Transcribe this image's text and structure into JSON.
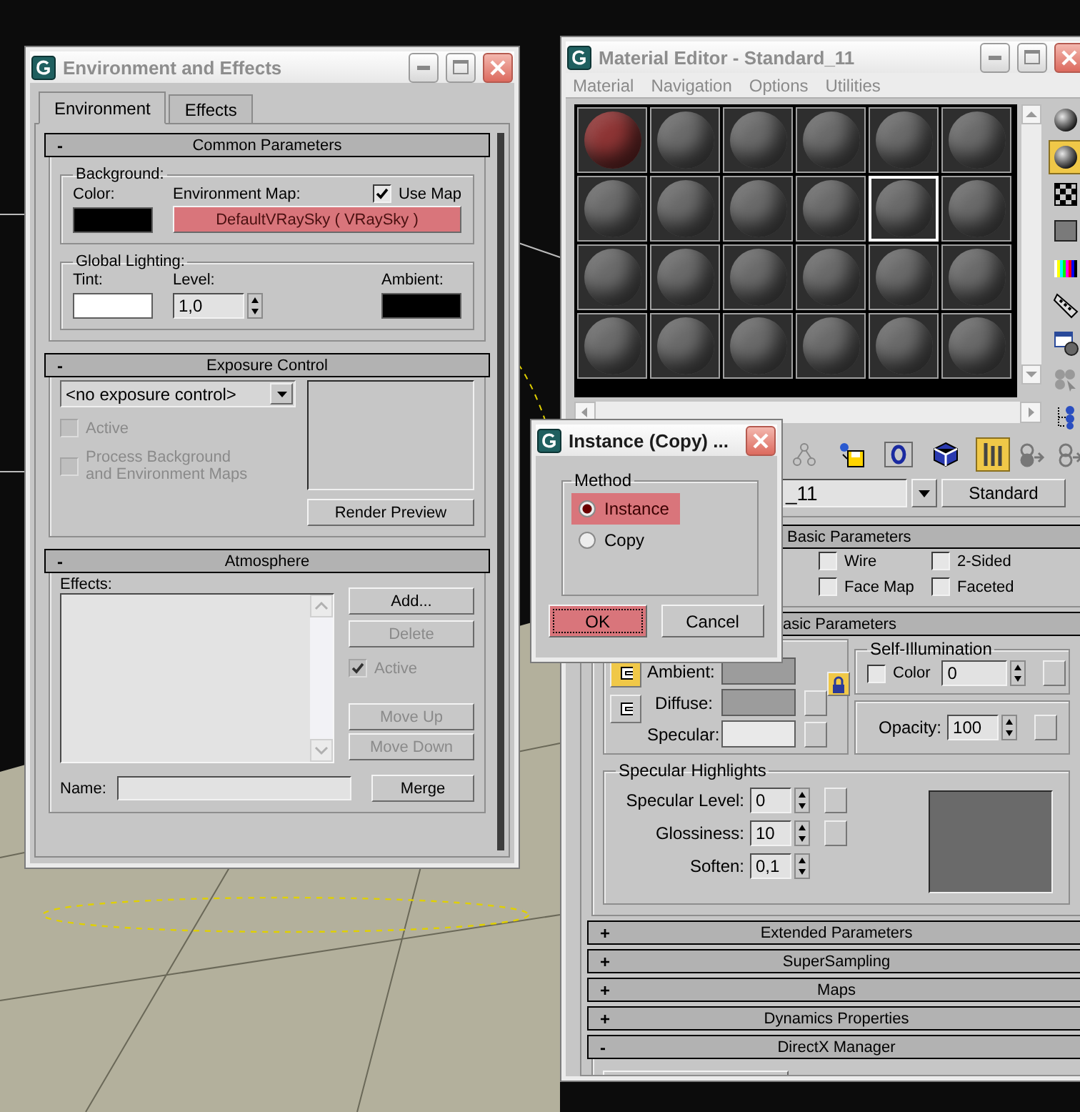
{
  "environment_window": {
    "title": "Environment and Effects",
    "tabs": [
      {
        "label": "Environment",
        "selected": true
      },
      {
        "label": "Effects",
        "selected": false
      }
    ],
    "common_parameters": {
      "toggle": "-",
      "title": "Common Parameters",
      "background": {
        "label": "Background:",
        "use_map": {
          "label": "Use Map",
          "checked": true
        },
        "items": [
          {
            "kind": "swatch",
            "label": "Color:",
            "color": "#000000"
          },
          {
            "kind": "map",
            "label": "Environment Map:",
            "button": "DefaultVRaySky  ( VRaySky )",
            "highlighted": true
          }
        ]
      },
      "global_lighting": {
        "label": "Global Lighting:",
        "items": [
          {
            "kind": "swatch",
            "label": "Tint:",
            "color": "#ffffff"
          },
          {
            "kind": "spinner",
            "label": "Level:",
            "value": "1,0"
          },
          {
            "kind": "swatch",
            "label": "Ambient:",
            "color": "#000000"
          }
        ]
      }
    },
    "exposure_control": {
      "toggle": "-",
      "title": "Exposure Control",
      "dropdown": "<no exposure control>",
      "options": [
        {
          "label": "Active",
          "checked": false,
          "disabled": true
        },
        {
          "label": "Process Background and Environment Maps",
          "checked": false,
          "disabled": true
        }
      ],
      "render_preview": "Render Preview"
    },
    "atmosphere": {
      "toggle": "-",
      "title": "Atmosphere",
      "effects_label": "Effects:",
      "buttons": [
        {
          "label": "Add...",
          "disabled": false
        },
        {
          "label": "Delete",
          "disabled": true
        }
      ],
      "active": {
        "label": "Active",
        "checked": true,
        "disabled": true
      },
      "move_buttons": [
        {
          "label": "Move Up",
          "disabled": true
        },
        {
          "label": "Move Down",
          "disabled": true
        }
      ],
      "name_label": "Name:",
      "merge": "Merge"
    }
  },
  "material_editor": {
    "title": "Material Editor - Standard_11",
    "menu": [
      "Material",
      "Navigation",
      "Options",
      "Utilities"
    ],
    "slots": [
      {
        "color": "#8e3535",
        "selected": false
      },
      {
        "color": "#6b6b6b",
        "selected": false
      },
      {
        "color": "#6b6b6b",
        "selected": false
      },
      {
        "color": "#6b6b6b",
        "selected": false
      },
      {
        "color": "#6b6b6b",
        "selected": false
      },
      {
        "color": "#6b6b6b",
        "selected": false
      },
      {
        "color": "#6b6b6b",
        "selected": false
      },
      {
        "color": "#6b6b6b",
        "selected": false
      },
      {
        "color": "#6b6b6b",
        "selected": false
      },
      {
        "color": "#6b6b6b",
        "selected": false
      },
      {
        "color": "#6b6b6b",
        "selected": true
      },
      {
        "color": "#6b6b6b",
        "selected": false
      },
      {
        "color": "#6b6b6b",
        "selected": false
      },
      {
        "color": "#6b6b6b",
        "selected": false
      },
      {
        "color": "#6b6b6b",
        "selected": false
      },
      {
        "color": "#6b6b6b",
        "selected": false
      },
      {
        "color": "#6b6b6b",
        "selected": false
      },
      {
        "color": "#6b6b6b",
        "selected": false
      },
      {
        "color": "#6b6b6b",
        "selected": false
      },
      {
        "color": "#6b6b6b",
        "selected": false
      },
      {
        "color": "#6b6b6b",
        "selected": false
      },
      {
        "color": "#6b6b6b",
        "selected": false
      },
      {
        "color": "#6b6b6b",
        "selected": false
      },
      {
        "color": "#6b6b6b",
        "selected": false
      }
    ],
    "side_tools": [
      {
        "kind": "sphere",
        "active": false
      },
      {
        "kind": "backlight",
        "active": true
      },
      {
        "kind": "checker",
        "active": false
      },
      {
        "kind": "square",
        "active": false
      },
      {
        "kind": "colorbars",
        "active": false
      },
      {
        "kind": "film",
        "active": false
      },
      {
        "kind": "options",
        "active": false
      },
      {
        "kind": "select",
        "active": false
      },
      {
        "kind": "nodes",
        "active": false
      }
    ],
    "toolbar": [
      {
        "kind": "tree",
        "active": false
      },
      {
        "kind": "disk",
        "active": false
      },
      {
        "kind": "ring",
        "active": false
      },
      {
        "kind": "cube",
        "active": false
      },
      {
        "kind": "bars",
        "active": true
      },
      {
        "kind": "up",
        "active": false
      },
      {
        "kind": "across",
        "active": false
      }
    ],
    "name_field": "_11",
    "type_button": "Standard",
    "shader_rollout": {
      "title": "Basic Parameters",
      "options": [
        {
          "label": "Wire",
          "checked": false
        },
        {
          "label": "2-Sided",
          "checked": false
        },
        {
          "label": "Face Map",
          "checked": false
        },
        {
          "label": "Faceted",
          "checked": false
        }
      ]
    },
    "blinn_rollout": {
      "title": "asic Parameters",
      "link_buttons": [
        {
          "active": true
        },
        {
          "active": false
        }
      ],
      "colors": [
        {
          "label": "Ambient:",
          "color": "#9c9c9c",
          "map": false
        },
        {
          "label": "Diffuse:",
          "color": "#9c9c9c",
          "map": true
        },
        {
          "label": "Specular:",
          "color": "#e9e9e9",
          "map": true
        }
      ],
      "lock_active": true,
      "self_illumination": {
        "label": "Self-Illumination",
        "color": {
          "label": "Color",
          "checked": false
        },
        "value": "0"
      },
      "opacity": {
        "label": "Opacity:",
        "value": "100"
      },
      "specular_highlights": {
        "label": "Specular Highlights",
        "fields": [
          {
            "label": "Specular Level:",
            "value": "0",
            "map": true
          },
          {
            "label": "Glossiness:",
            "value": "10",
            "map": true
          },
          {
            "label": "Soften:",
            "value": "0,1",
            "map": false
          }
        ]
      }
    },
    "rollouts": [
      {
        "toggle": "+",
        "title": "Extended Parameters"
      },
      {
        "toggle": "+",
        "title": "SuperSampling"
      },
      {
        "toggle": "+",
        "title": "Maps"
      },
      {
        "toggle": "+",
        "title": "Dynamics Properties"
      },
      {
        "toggle": "-",
        "title": "DirectX Manager"
      }
    ]
  },
  "dialog": {
    "title": "Instance (Copy) ...",
    "group": "Method",
    "options": [
      {
        "label": "Instance",
        "selected": true,
        "highlighted": true
      },
      {
        "label": "Copy",
        "selected": false,
        "highlighted": false
      }
    ],
    "buttons": [
      {
        "label": "OK",
        "highlighted": true,
        "focused": true
      },
      {
        "label": "Cancel",
        "highlighted": false,
        "focused": false
      }
    ]
  }
}
